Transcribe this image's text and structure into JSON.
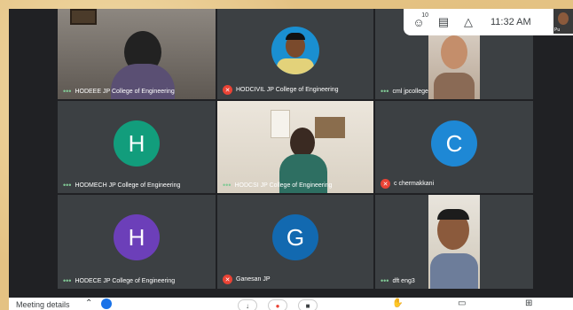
{
  "topbar": {
    "people_icon": "people-icon",
    "people_badge": "10",
    "chat_icon": "chat-icon",
    "activities_icon": "activities-icon",
    "time": "11:32 AM",
    "self_label": "Pu"
  },
  "tiles": [
    {
      "name": "HODEEE JP College of Engineering",
      "muted": false,
      "type": "video"
    },
    {
      "name": "HODCIVIL JP College of Engineering",
      "muted": true,
      "type": "photo"
    },
    {
      "name": "cml jpcollege",
      "muted": false,
      "type": "video"
    },
    {
      "name": "HODMECH JP College of Engineering",
      "muted": false,
      "type": "avatar",
      "initial": "H",
      "color": "#129d7c"
    },
    {
      "name": "HODCSI JP College of Engineering",
      "muted": false,
      "type": "video"
    },
    {
      "name": "c chermakkani",
      "muted": true,
      "type": "avatar",
      "initial": "C",
      "color": "#1e88d5"
    },
    {
      "name": "HODECE JP College of Engineering",
      "muted": false,
      "type": "avatar",
      "initial": "H",
      "color": "#6c3fb9"
    },
    {
      "name": "Ganesan JP",
      "muted": true,
      "type": "avatar",
      "initial": "G",
      "color": "#1269b0"
    },
    {
      "name": "dft eng3",
      "muted": false,
      "type": "video"
    }
  ],
  "bottombar": {
    "meeting_details": "Meeting details",
    "mic_icon": "microphone-icon",
    "end_call_icon": "end-call-icon",
    "camera_icon": "camera-icon",
    "raise_hand_icon": "raise-hand-icon",
    "captions_icon": "captions-icon",
    "present_icon": "present-icon"
  }
}
